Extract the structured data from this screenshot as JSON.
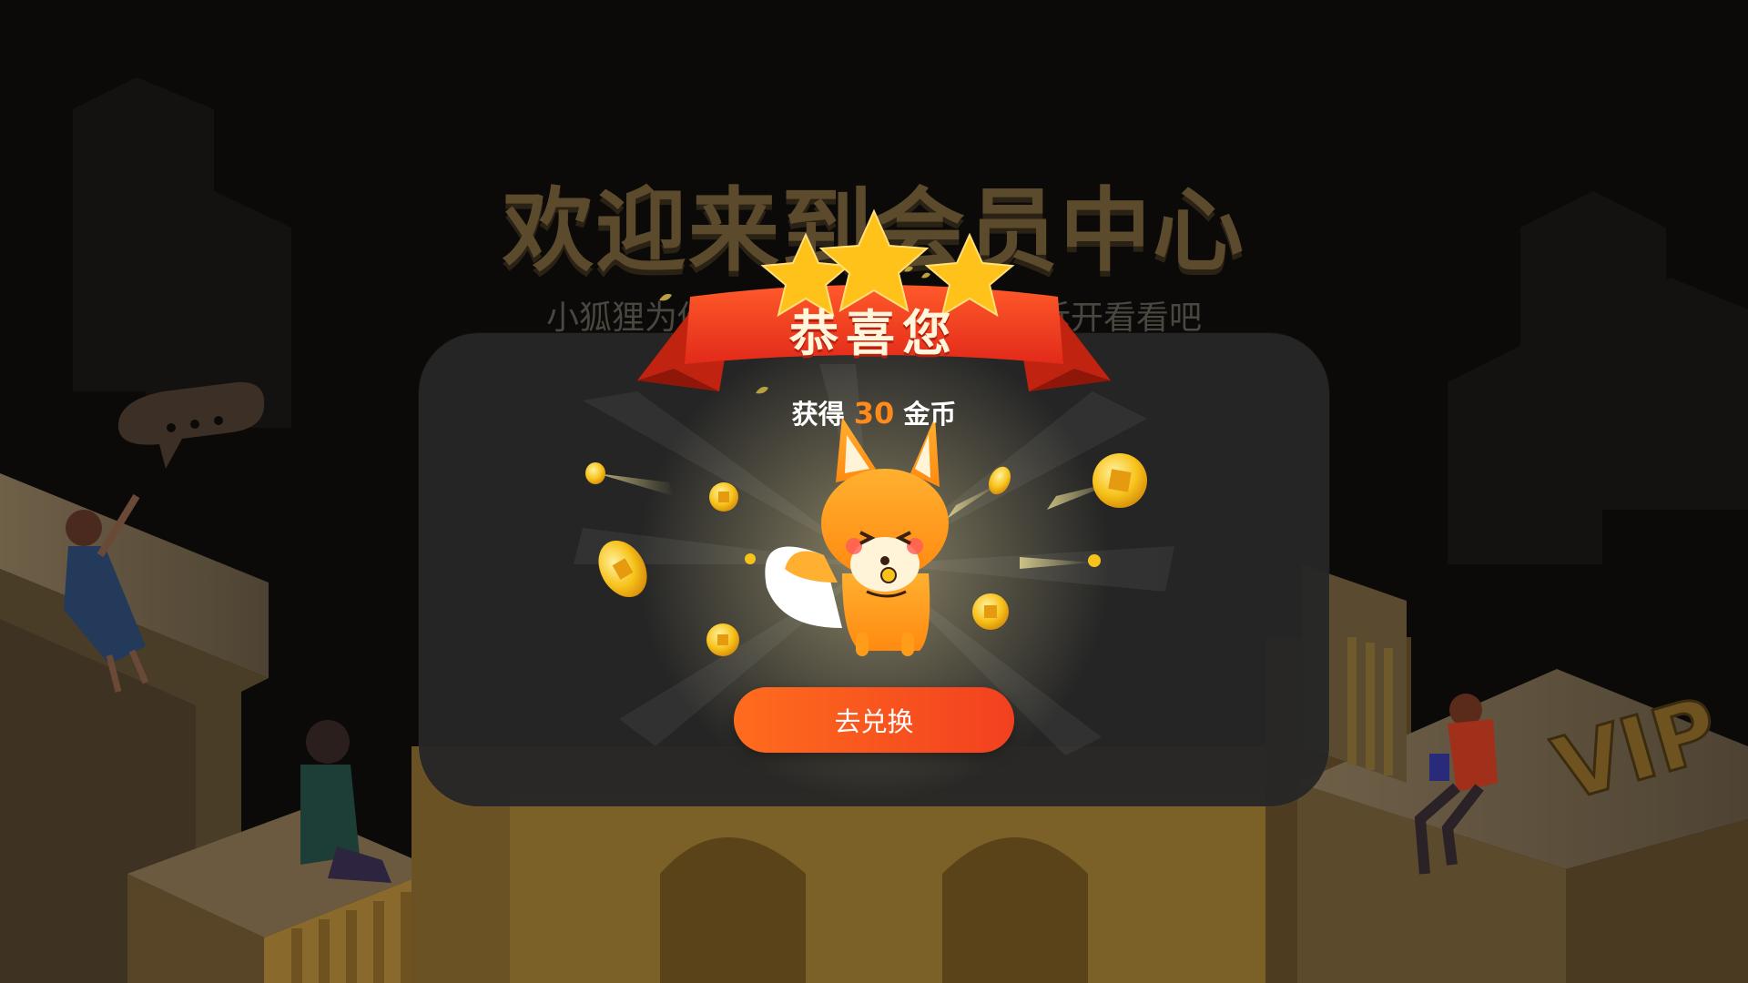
{
  "background": {
    "headline": "欢迎来到会员中心",
    "subline": "小狐狸为你准备了一份礼物，快来拆开看看吧",
    "vip_sign": "VIP"
  },
  "popup": {
    "title": "恭喜您",
    "award_prefix": "获得",
    "award_amount": "30",
    "award_unit": "金币",
    "button_label": "去兑换",
    "star_count": 3
  },
  "colors": {
    "accent": "#f25a1f",
    "ribbon": "#e8351f",
    "star": "#ffc21a",
    "coin": "#f7c21a",
    "fox": "#ff9d1a",
    "modal_bg": "#262626"
  },
  "icons": [
    "star-icon",
    "ribbon-banner",
    "coin-icon",
    "fox-mascot",
    "speech-bubble-icon"
  ]
}
